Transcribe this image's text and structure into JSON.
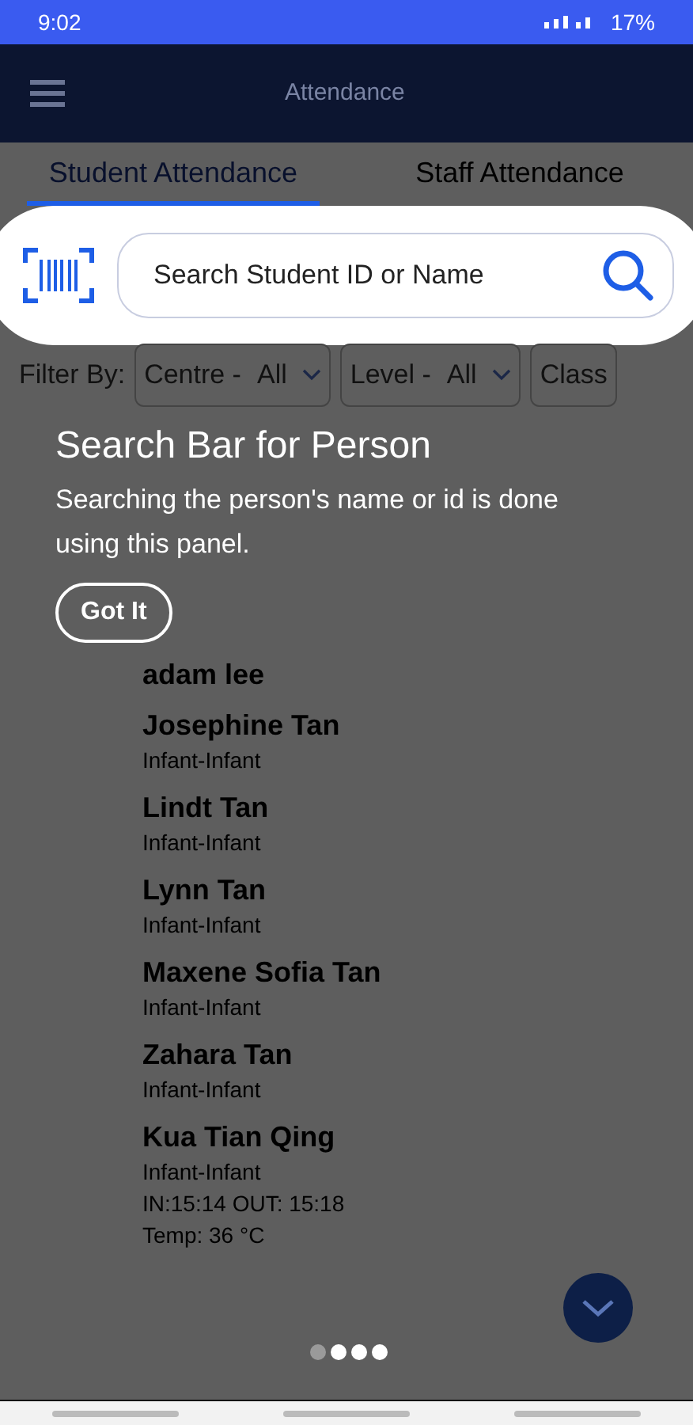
{
  "status_bar": {
    "time": "9:02",
    "battery": "17%"
  },
  "app_bar": {
    "title": "Attendance"
  },
  "tabs": [
    {
      "label": "Student Attendance",
      "selected": true
    },
    {
      "label": "Staff Attendance",
      "selected": false
    }
  ],
  "search": {
    "placeholder": "Search Student ID or Name"
  },
  "filters": {
    "label": "Filter By:",
    "dropdowns": [
      {
        "label": "Centre -",
        "value": "All"
      },
      {
        "label": "Level -",
        "value": "All"
      },
      {
        "label": "Class"
      }
    ]
  },
  "students": [
    {
      "name": "adam lee"
    },
    {
      "name": "Josephine Tan",
      "level": "Infant-Infant"
    },
    {
      "name": "Lindt Tan",
      "level": "Infant-Infant"
    },
    {
      "name": "Lynn Tan",
      "level": "Infant-Infant"
    },
    {
      "name": "Maxene Sofia Tan",
      "level": "Infant-Infant"
    },
    {
      "name": "Zahara Tan",
      "level": "Infant-Infant"
    },
    {
      "name": "Kua Tian Qing",
      "level": "Infant-Infant",
      "times": "IN:15:14 OUT: 15:18",
      "temp": "Temp: 36 °C"
    }
  ],
  "tutorial": {
    "title": "Search Bar for Person",
    "body": "Searching the person's name or id is done using this panel.",
    "button": "Got It"
  },
  "pager": [
    {
      "selected": true
    },
    {
      "selected": false
    },
    {
      "selected": false
    },
    {
      "selected": false
    }
  ]
}
